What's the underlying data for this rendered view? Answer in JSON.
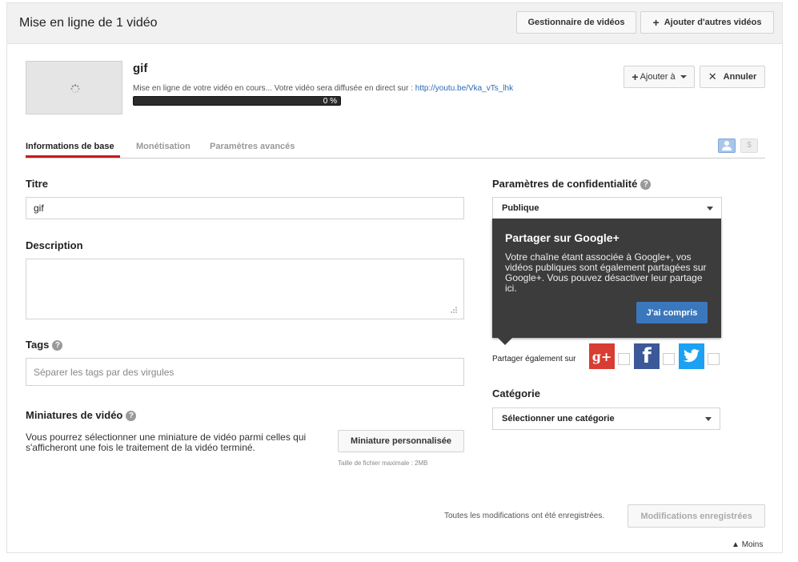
{
  "header": {
    "title": "Mise en ligne de 1 vidéo",
    "manager_button": "Gestionnaire de vidéos",
    "add_videos_button": "Ajouter d'autres vidéos"
  },
  "upload": {
    "video_title": "gif",
    "status_text": "Mise en ligne de votre vidéo en cours... Votre vidéo sera diffusée en direct sur : ",
    "link": "http://youtu.be/Vka_vTs_lhk",
    "progress_label": "0 %",
    "progress_fraction": 0,
    "add_to_button": "Ajouter à",
    "cancel_button": "Annuler"
  },
  "tabs": [
    {
      "label": "Informations de base",
      "active": true
    },
    {
      "label": "Monétisation",
      "active": false
    },
    {
      "label": "Paramètres avancés",
      "active": false
    }
  ],
  "tab_icons": {
    "money_symbol": "$"
  },
  "form": {
    "title_label": "Titre",
    "title_value": "gif",
    "description_label": "Description",
    "description_value": "",
    "tags_label": "Tags",
    "tags_placeholder": "Séparer les tags par des virgules",
    "thumbnails_label": "Miniatures de vidéo",
    "thumbnails_text": "Vous pourrez sélectionner une miniature de vidéo parmi celles qui s'afficheront une fois le traitement de la vidéo terminé.",
    "custom_thumbnail_button": "Miniature personnalisée",
    "max_file_size": "Taille de fichier maximale : 2MB"
  },
  "privacy": {
    "label": "Paramètres de confidentialité",
    "selected": "Publique"
  },
  "popover": {
    "title": "Partager sur Google+",
    "body": "Votre chaîne étant associée à Google+, vos vidéos publiques sont également partagées sur Google+. Vous pouvez désactiver leur partage ici.",
    "button": "J'ai compris"
  },
  "share": {
    "label": "Partager également sur",
    "gplus_glyph": "g+",
    "facebook_glyph": "f"
  },
  "category": {
    "label": "Catégorie",
    "selected": "Sélectionner une catégorie"
  },
  "footer": {
    "saved_text": "Toutes les modifications ont été enregistrées.",
    "saved_button": "Modifications enregistrées",
    "less_link": "Moins"
  },
  "help_glyph": "?",
  "colors": {
    "accent_red": "#cc181e",
    "primary_blue": "#3b77bc",
    "link_blue": "#2b6ab3",
    "google_plus": "#d73d32",
    "facebook": "#3b5998",
    "twitter": "#1da1f2",
    "popover_bg": "#3c3c3c"
  }
}
